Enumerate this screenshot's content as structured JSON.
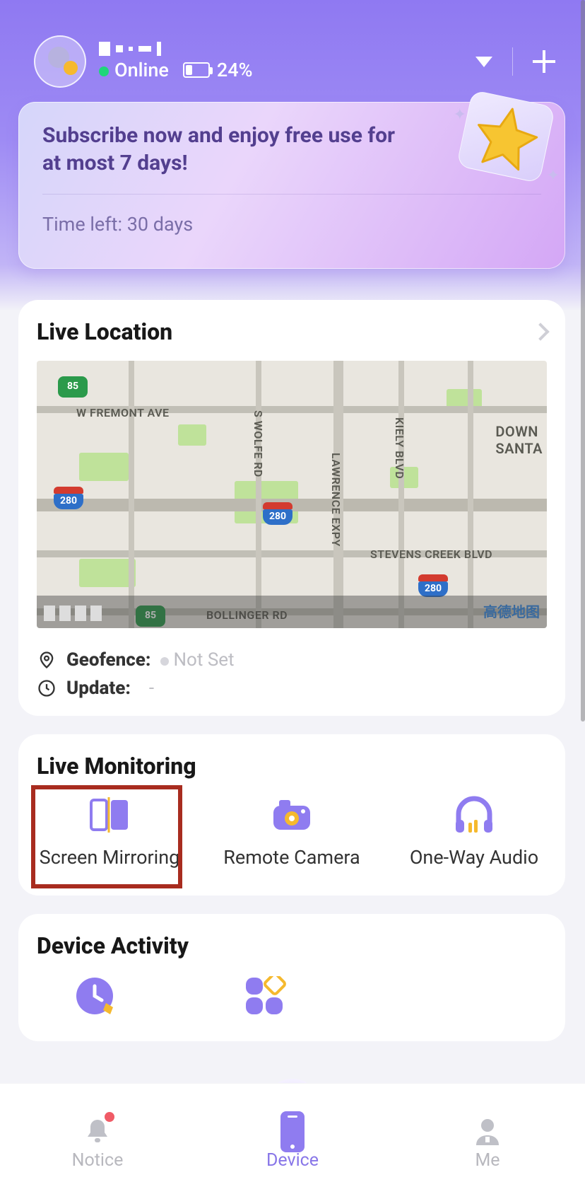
{
  "header": {
    "status_text": "Online",
    "battery_text": "24%"
  },
  "promo": {
    "title": "Subscribe now and enjoy free use for at most 7 days!",
    "time_left": "Time left: 30 days"
  },
  "location": {
    "title": "Live Location",
    "geofence_label": "Geofence:",
    "geofence_value": "Not Set",
    "update_label": "Update:",
    "update_value": "-",
    "map_labels": {
      "fremont": "W FREMONT AVE",
      "wolfe": "S WOLFE RD",
      "lawrence": "LAWRENCE EXPY",
      "kiely": "KIELY BLVD",
      "stevens": "STEVENS CREEK BLVD",
      "bollinger": "BOLLINGER RD",
      "down_santa": "DOWN\nSANTA"
    },
    "shields": {
      "r85": "85",
      "r280": "280"
    },
    "map_provider": "高德地图"
  },
  "monitoring": {
    "title": "Live Monitoring",
    "items": [
      "Screen Mirroring",
      "Remote Camera",
      "One-Way Audio"
    ]
  },
  "activity": {
    "title": "Device Activity"
  },
  "tabs": {
    "notice": "Notice",
    "device": "Device",
    "me": "Me"
  }
}
